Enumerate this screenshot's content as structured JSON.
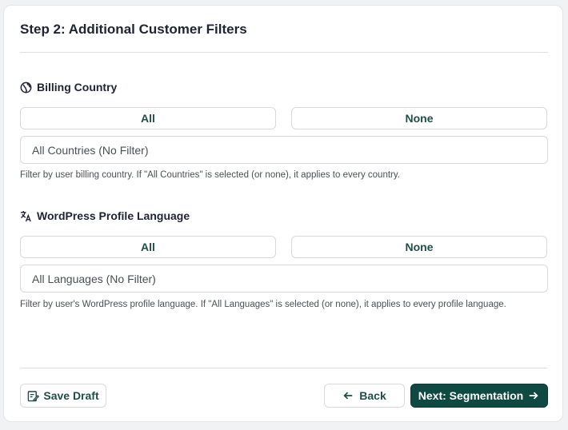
{
  "step": {
    "title": "Step 2: Additional Customer Filters"
  },
  "billing": {
    "label": "Billing Country",
    "icon": "globe-icon",
    "all_label": "All",
    "none_label": "None",
    "select_value": "All Countries (No Filter)",
    "help": "Filter by user billing country. If \"All Countries\" is selected (or none), it applies to every country."
  },
  "language": {
    "label": "WordPress Profile Language",
    "icon": "translate-icon",
    "all_label": "All",
    "none_label": "None",
    "select_value": "All Languages (No Filter)",
    "help": "Filter by user's WordPress profile language. If \"All Languages\" is selected (or none), it applies to every profile language."
  },
  "footer": {
    "save_draft": "Save Draft",
    "back": "Back",
    "next": "Next: Segmentation"
  },
  "colors": {
    "primary": "#0f4a42",
    "accent_text": "#1f4f45",
    "border": "#d6dadd"
  }
}
